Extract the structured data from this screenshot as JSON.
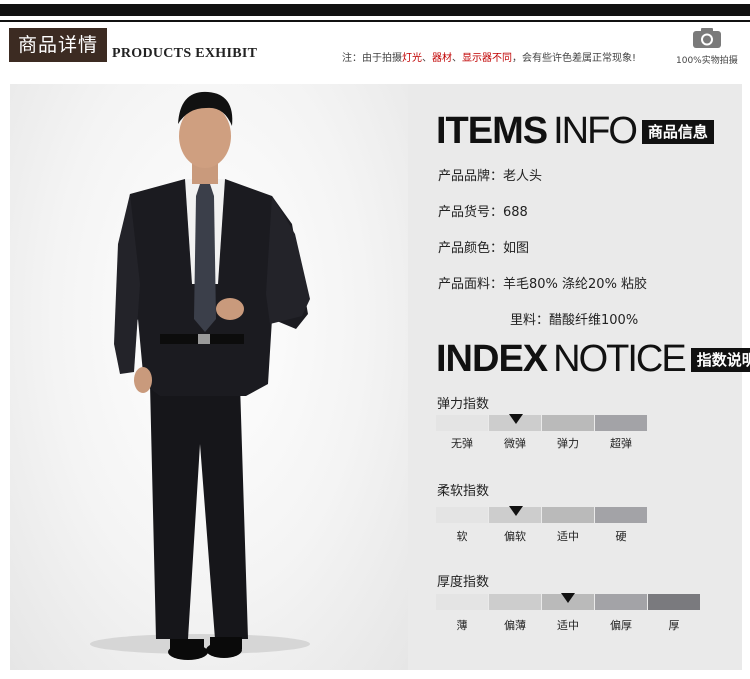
{
  "header": {
    "tag_cn": "商品详情",
    "tag_en": "PRODUCTS EXHIBIT",
    "note_parts": [
      "注：由于拍摄",
      "灯光",
      "、",
      "器材",
      "、",
      "显示器不同",
      "，会有些许色差属正常现象!"
    ],
    "camera_label": "100%实物拍摄"
  },
  "items_info": {
    "title_bold": "ITEMS",
    "title_thin": "INFO",
    "badge": "商品信息",
    "lines": [
      "产品品牌：老人头",
      "产品货号：688",
      "产品颜色：如图",
      "产品面料：羊毛80% 涤纶20% 粘胶",
      "里料：醋酸纤维100%"
    ]
  },
  "index_notice": {
    "title_bold": "INDEX",
    "title_thin": "NOTICE",
    "badge": "指数说明",
    "groups": [
      {
        "title": "弹力指数",
        "labels": [
          "无弹",
          "微弹",
          "弹力",
          "超弹"
        ],
        "selected": 1
      },
      {
        "title": "柔软指数",
        "labels": [
          "软",
          "偏软",
          "适中",
          "硬"
        ],
        "selected": 1
      },
      {
        "title": "厚度指数",
        "labels": [
          "薄",
          "偏薄",
          "适中",
          "偏厚",
          "厚"
        ],
        "selected": 2
      }
    ]
  },
  "colors": {
    "scale_shades": [
      "#e4e4e4",
      "#cdcdcd",
      "#bababa",
      "#a3a3a7",
      "#7a7a7e"
    ],
    "note_highlight": "#c00000",
    "tag_bg": "#3c2b22"
  }
}
